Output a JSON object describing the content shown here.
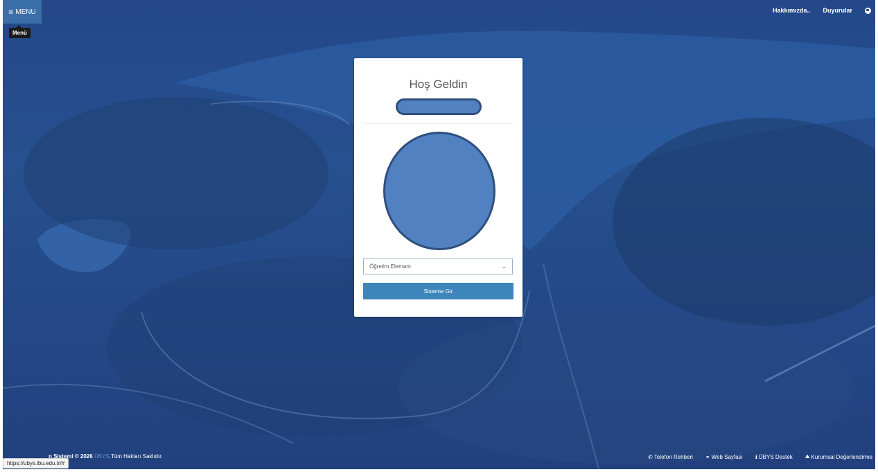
{
  "header": {
    "menu_label": "MENU",
    "menu_tooltip": "Menü",
    "links": [
      "Hakkımızda..",
      "Duyurular"
    ]
  },
  "login": {
    "title": "Hoş Geldin",
    "role_select": {
      "value": "Öğretim Elemanı"
    },
    "submit_label": "Sisteme Gir"
  },
  "footer": {
    "copyright_bold": "n Sistemi © 2026",
    "brand": "ÜBYS",
    "rights": ".Tüm Hakları Saklıdır.",
    "status_url": "https://ubys.ibu.edu.tr/#",
    "links": [
      {
        "label": "Telefon Rehberi",
        "icon": "phone-icon"
      },
      {
        "label": "Web Sayfası",
        "icon": "link-icon"
      },
      {
        "label": "ÜBYS Destek",
        "icon": "info-icon"
      },
      {
        "label": "Kurumsal Değerlendirme",
        "icon": "image-icon"
      }
    ]
  },
  "colors": {
    "background_overlay": "#24488a",
    "button": "#3c86bb",
    "menu_button": "#3a6fa8",
    "placeholder_fill": "#5181c0"
  }
}
